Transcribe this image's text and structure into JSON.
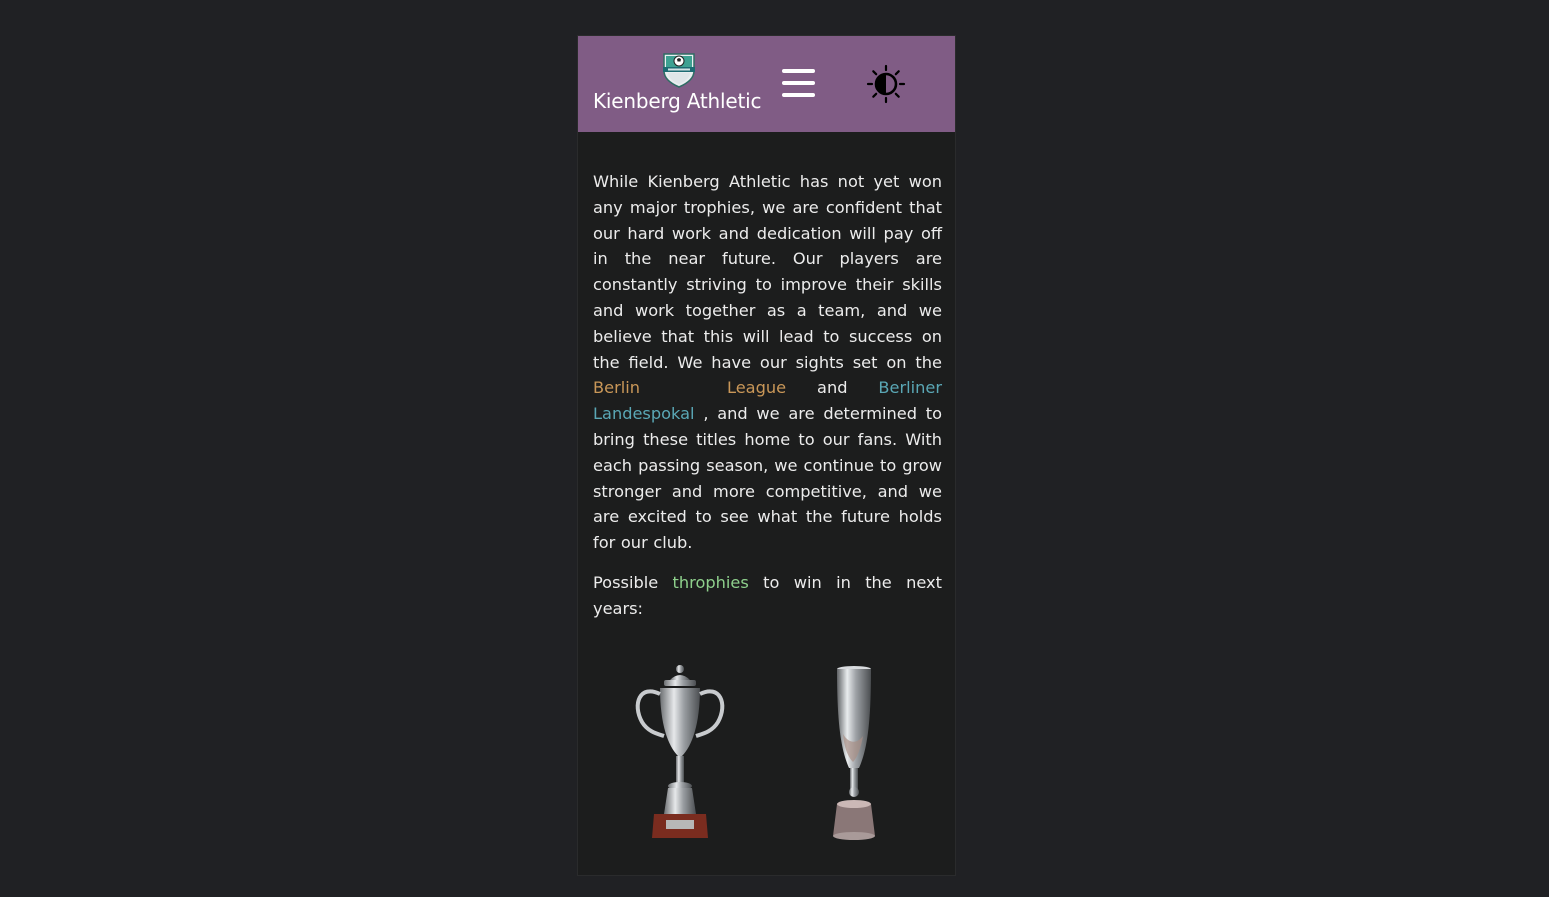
{
  "header": {
    "title": "Kienberg Athletic",
    "logo_icon": "club-crest-icon",
    "menu_icon": "hamburger-menu-icon",
    "theme_icon": "theme-toggle-icon",
    "background_color": "#805c85"
  },
  "content": {
    "intro_1": "While Kienberg Athletic has not yet won any major trophies, we are confident that our hard work and dedication will pay off in the near future. Our players are constantly striving to improve their skills and work together as a team, and we believe that this will lead to success on the field. We have our sights set on the ",
    "link_berlin": "Berlin",
    "link_league": "League",
    "and_word": " and ",
    "link_landespokal": "Berliner Landespokal",
    "intro_2": " , and we are determined to bring these titles home to our fans. With each passing season, we continue to grow stronger and more competitive, and we are excited to see what the future holds for our club.",
    "possible_1": "Possible ",
    "link_trophies": "throphies",
    "possible_2": " to win in the next years:"
  },
  "trophies": [
    {
      "icon": "league-trophy-icon"
    },
    {
      "icon": "cup-trophy-icon"
    }
  ],
  "colors": {
    "page_bg": "#202124",
    "panel_bg": "#1c1d1d",
    "link_orange": "#c99758",
    "link_blue": "#5aa7b5",
    "link_green": "#8ed08c"
  }
}
